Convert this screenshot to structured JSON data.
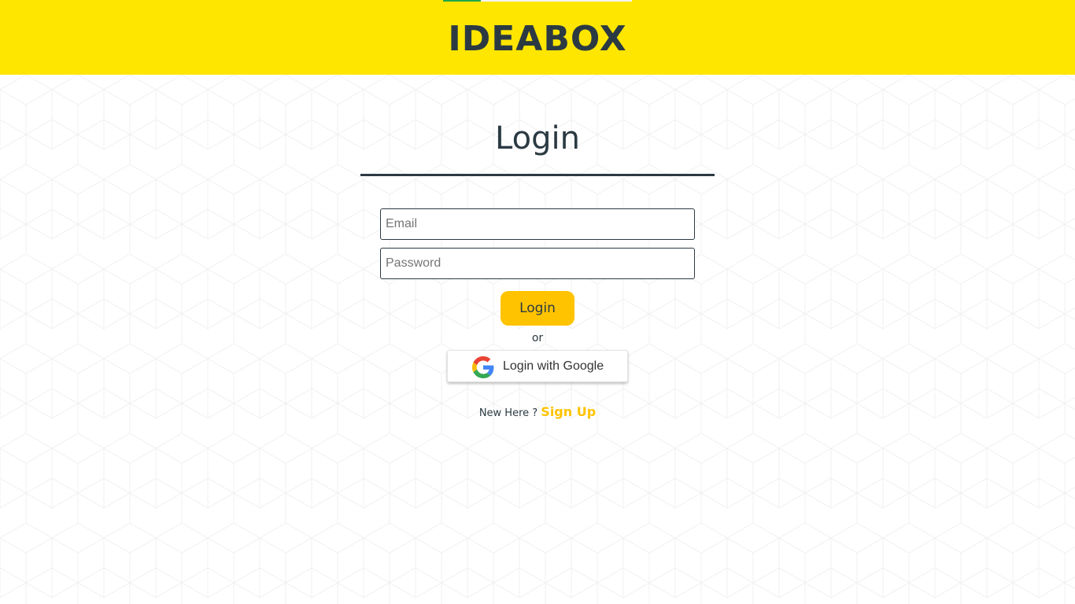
{
  "header": {
    "brand": "IDEABOX",
    "background_color": "#ffe600",
    "loading_progress": 0.2,
    "progress_color": "#1fa84a"
  },
  "login": {
    "title": "Login",
    "email_placeholder": "Email",
    "password_placeholder": "Password",
    "email_value": "",
    "password_value": "",
    "login_button_label": "Login",
    "or_text": "or",
    "google_button_label": "Login with Google",
    "google_icon": "google-g-logo",
    "new_here_text": "New Here ?",
    "signup_link_label": "Sign Up"
  },
  "colors": {
    "text_dark": "#2b3a42",
    "accent": "#ffc300",
    "background": "#ffffff"
  }
}
